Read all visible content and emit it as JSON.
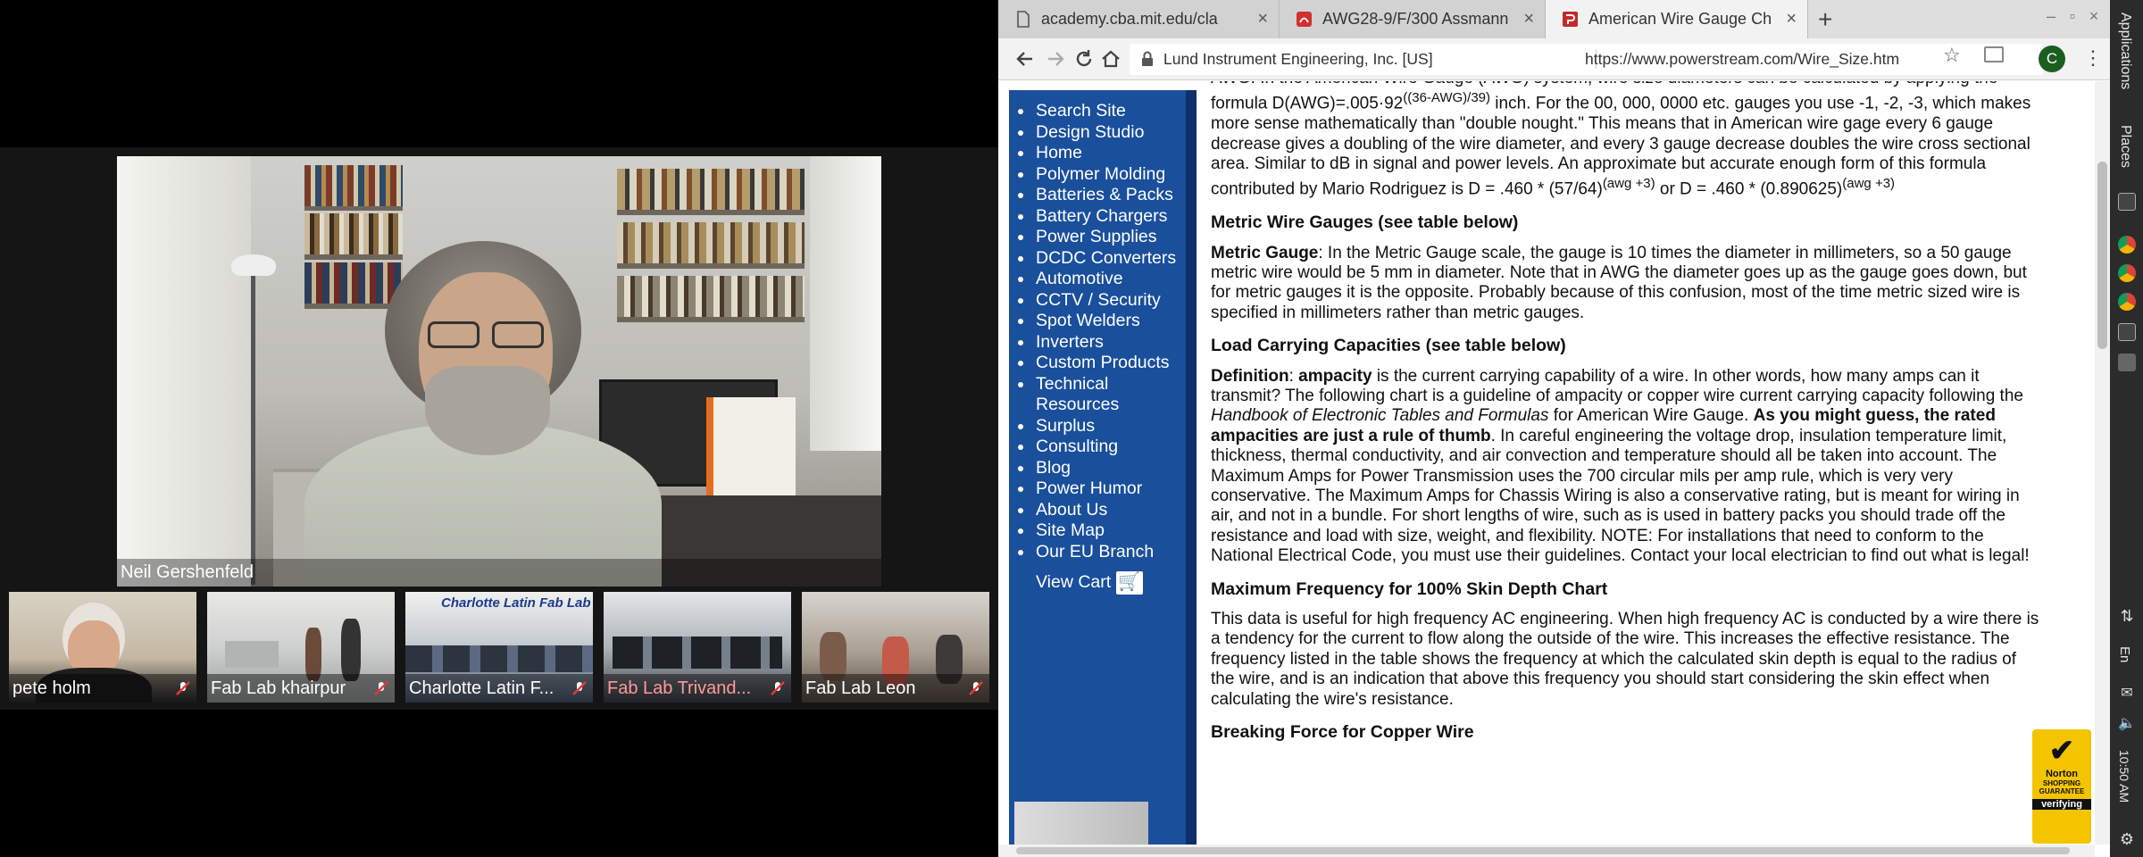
{
  "video_call": {
    "main_speaker": "Neil Gershenfeld",
    "participants": [
      {
        "name": "pete holm"
      },
      {
        "name": "Fab Lab khairpur"
      },
      {
        "name": "Charlotte Latin F..."
      },
      {
        "name": "Fab Lab Trivand..."
      },
      {
        "name": "Fab Lab Leon"
      }
    ],
    "thumb_overlay_text": "Charlotte Latin Fab Lab"
  },
  "browser": {
    "tabs": [
      {
        "title": "academy.cba.mit.edu/cla"
      },
      {
        "title": "AWG28-9/F/300 Assmann"
      },
      {
        "title": "American Wire Gauge Ch"
      }
    ],
    "new_tab": "+",
    "cert_label": "Lund Instrument Engineering, Inc. [US]",
    "url": "https://www.powerstream.com/Wire_Size.htm",
    "profile_initial": "C",
    "colors": {
      "nav_bg": "#1a4f9c",
      "tab_active": "#f2f2f2",
      "norton": "#f4c400"
    }
  },
  "sidenav": {
    "items": [
      "Search Site",
      "Design Studio",
      "Home",
      "Polymer Molding",
      "Batteries & Packs",
      "Battery Chargers",
      "Power Supplies",
      "DCDC Converters",
      "Automotive",
      "CCTV / Security",
      "Spot Welders",
      "Inverters",
      "Custom Products",
      "Technical Resources",
      "Surplus",
      "Consulting",
      "Blog",
      "Power Humor",
      "About Us",
      "Site Map",
      "Our EU Branch"
    ],
    "cart_label": "View Cart"
  },
  "article": {
    "awg_p1": "AWG: In the American Wire Gauge (AWG) system, wire size diameters can be calculated by applying the formula D(AWG)=.005·92",
    "awg_formula_exp": "((36-AWG)/39)",
    "awg_p1b": " inch. For the 00, 000, 0000 etc. gauges you use -1, -2, -3, which makes more sense mathematically than \"double nought.\" This means that in American wire gage every 6 gauge decrease gives a doubling of the wire diameter, and every 3 gauge decrease doubles the wire cross sectional area. Similar to dB in signal and power levels. An approximate but accurate enough form of this formula contributed by Mario Rodriguez is D = .460 * (57/64)",
    "awg_exp1": "(awg +3)",
    "awg_mid": " or D = .460 * (0.890625)",
    "awg_exp2": "(awg +3)",
    "metric_heading": "Metric Wire Gauges (see table below)",
    "metric_term": "Metric Gauge",
    "metric_text": ": In the Metric Gauge scale, the gauge is 10 times the diameter in millimeters, so a 50 gauge metric wire would be 5 mm in diameter. Note that in AWG the diameter goes up as the gauge goes down, but for metric gauges it is the opposite. Probably because of this confusion, most of the time metric sized wire is specified in millimeters rather than metric gauges.",
    "load_heading": "Load Carrying Capacities (see table below)",
    "def_term": "Definition",
    "def_colon": ": ",
    "ampacity_term": "ampacity",
    "def_text1": " is the current carrying capability of a wire. In other words, how many amps can it transmit? The following chart is a guideline of ampacity or copper wire current carrying capacity following the ",
    "handbook": "Handbook of Electronic Tables and Formulas",
    "def_text2": " for American Wire Gauge. ",
    "bold_guess": "As you might guess, the rated ampacities are just a rule of thumb",
    "def_text3": ". In careful engineering the voltage drop, insulation temperature limit, thickness, thermal conductivity, and air convection and temperature should all be taken into account. The Maximum Amps for Power Transmission uses the 700 circular mils per amp rule, which is very very conservative. The Maximum Amps for Chassis Wiring is also a conservative rating, but is meant for wiring in air, and not in a bundle. For short lengths of wire, such as is used in battery packs you should trade off the resistance and load with size, weight, and flexibility. NOTE: For installations that need to conform to the National Electrical Code, you must use their guidelines. Contact your local electrician to find out what is legal!",
    "skin_heading": "Maximum Frequency for 100% Skin Depth Chart",
    "skin_text": "This data is useful for high frequency AC engineering. When high frequency AC is conducted by a wire there is a tendency for the current to flow along the outside of the wire. This increases the effective resistance. The frequency listed in the table shows the frequency at which the calculated skin depth is equal to the radius of the wire, and is an indication that above this frequency you should start considering the skin effect when calculating the wire's resistance.",
    "break_heading": "Breaking Force for Copper Wire",
    "norton_brand": "Norton",
    "norton_sub": "SHOPPING GUARANTEE",
    "norton_verify": "verifying"
  },
  "desktop_panel": {
    "applications": "Applications",
    "places": "Places",
    "lang": "En",
    "clock": "10:50 AM"
  }
}
